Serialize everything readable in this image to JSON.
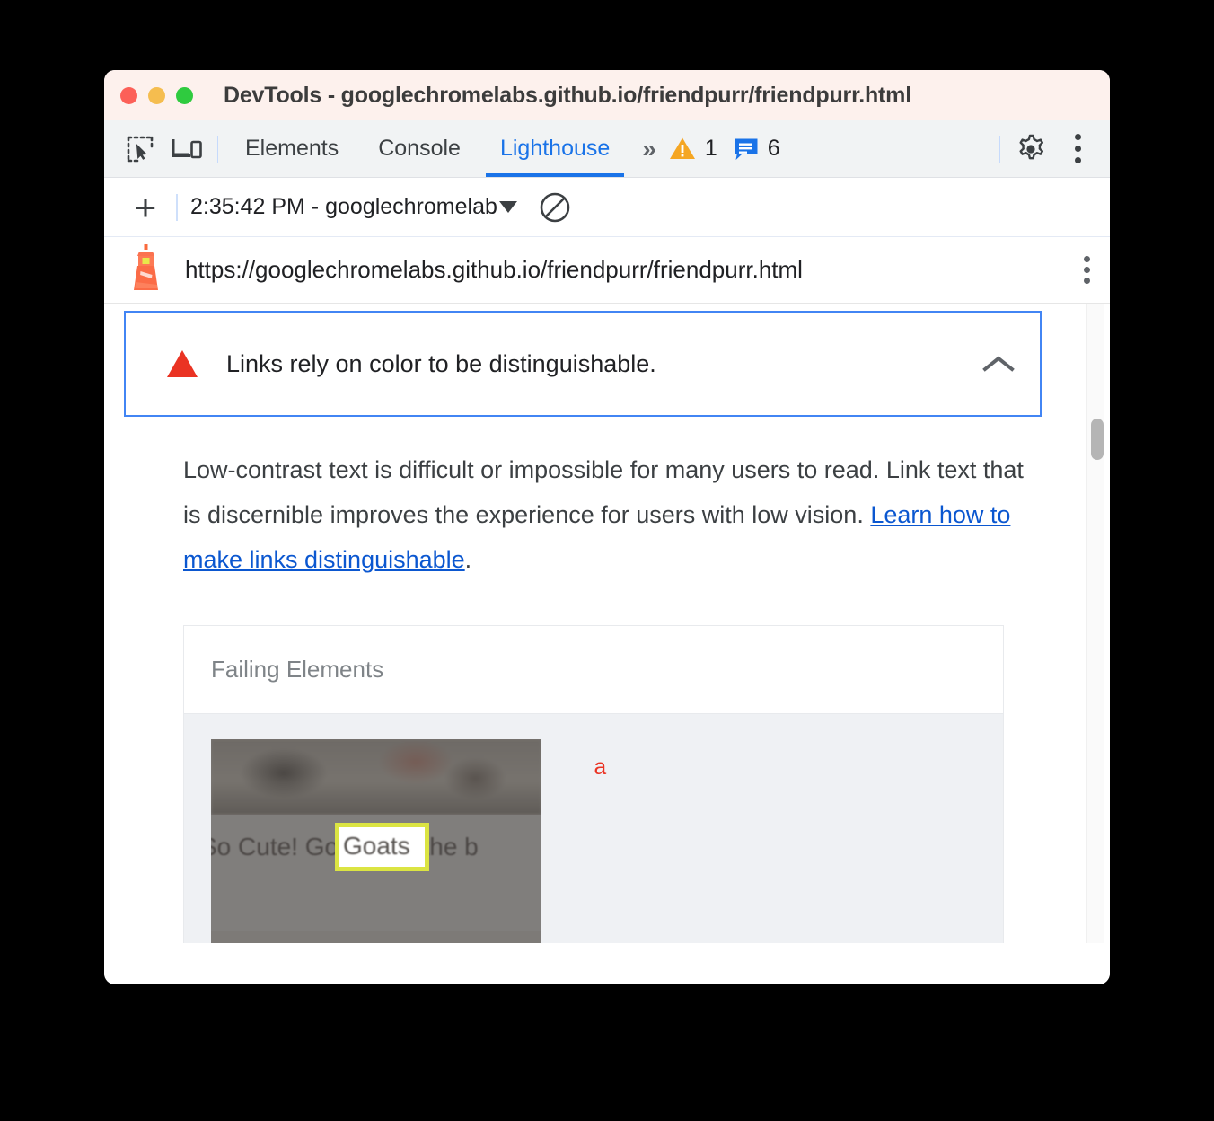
{
  "window": {
    "title": "DevTools - googlechromelabs.github.io/friendpurr/friendpurr.html",
    "traffic_lights": [
      "close-red",
      "minimize-yellow",
      "maximize-green"
    ]
  },
  "devtools_tabbar": {
    "inspect_icon": "inspect-element-icon",
    "device_icon": "device-toolbar-icon",
    "tabs": [
      {
        "label": "Elements",
        "active": false
      },
      {
        "label": "Console",
        "active": false
      },
      {
        "label": "Lighthouse",
        "active": true
      }
    ],
    "more_tabs": "»",
    "warning_icon": "warning-triangle-icon",
    "warning_count": "1",
    "info_icon": "message-info-icon",
    "info_count": "6",
    "settings_icon": "gear-icon",
    "overflow_icon": "vertical-dots-icon",
    "active_tab_color": "#1a73e8"
  },
  "lighthouse_toolbar": {
    "new_report_label": "+",
    "report_select_value": "2:35:42 PM - googlechromelab",
    "caret_icon": "caret-down-icon",
    "clear_icon": "clear-prohibited-icon"
  },
  "url_row": {
    "logo_icon": "lighthouse-logo-icon",
    "url": "https://googlechromelabs.github.io/friendpurr/friendpurr.html",
    "menu_icon": "vertical-dots-icon"
  },
  "audit": {
    "error_icon": "red-triangle-error-icon",
    "title": "Links rely on color to be distinguishable.",
    "collapse_icon": "chevron-up-icon",
    "border_color": "#4285f4",
    "description_part1": "Low-contrast text is difficult or impossible for many users to read. Link text that is discernible improves the experience for users with low vision. ",
    "description_link": "Learn how to make links distinguishable",
    "description_part2": "."
  },
  "failing_elements": {
    "header": "Failing Elements",
    "rows": [
      {
        "thumbnail_caption": "So Cute! Goats are the b",
        "highlighted_text": "Goats",
        "highlight_color": "#dbe442",
        "snippet": "a",
        "snippet_color": "#ea3323"
      }
    ]
  },
  "scrollbar": {
    "thumb": "vertical-scroll-thumb"
  }
}
